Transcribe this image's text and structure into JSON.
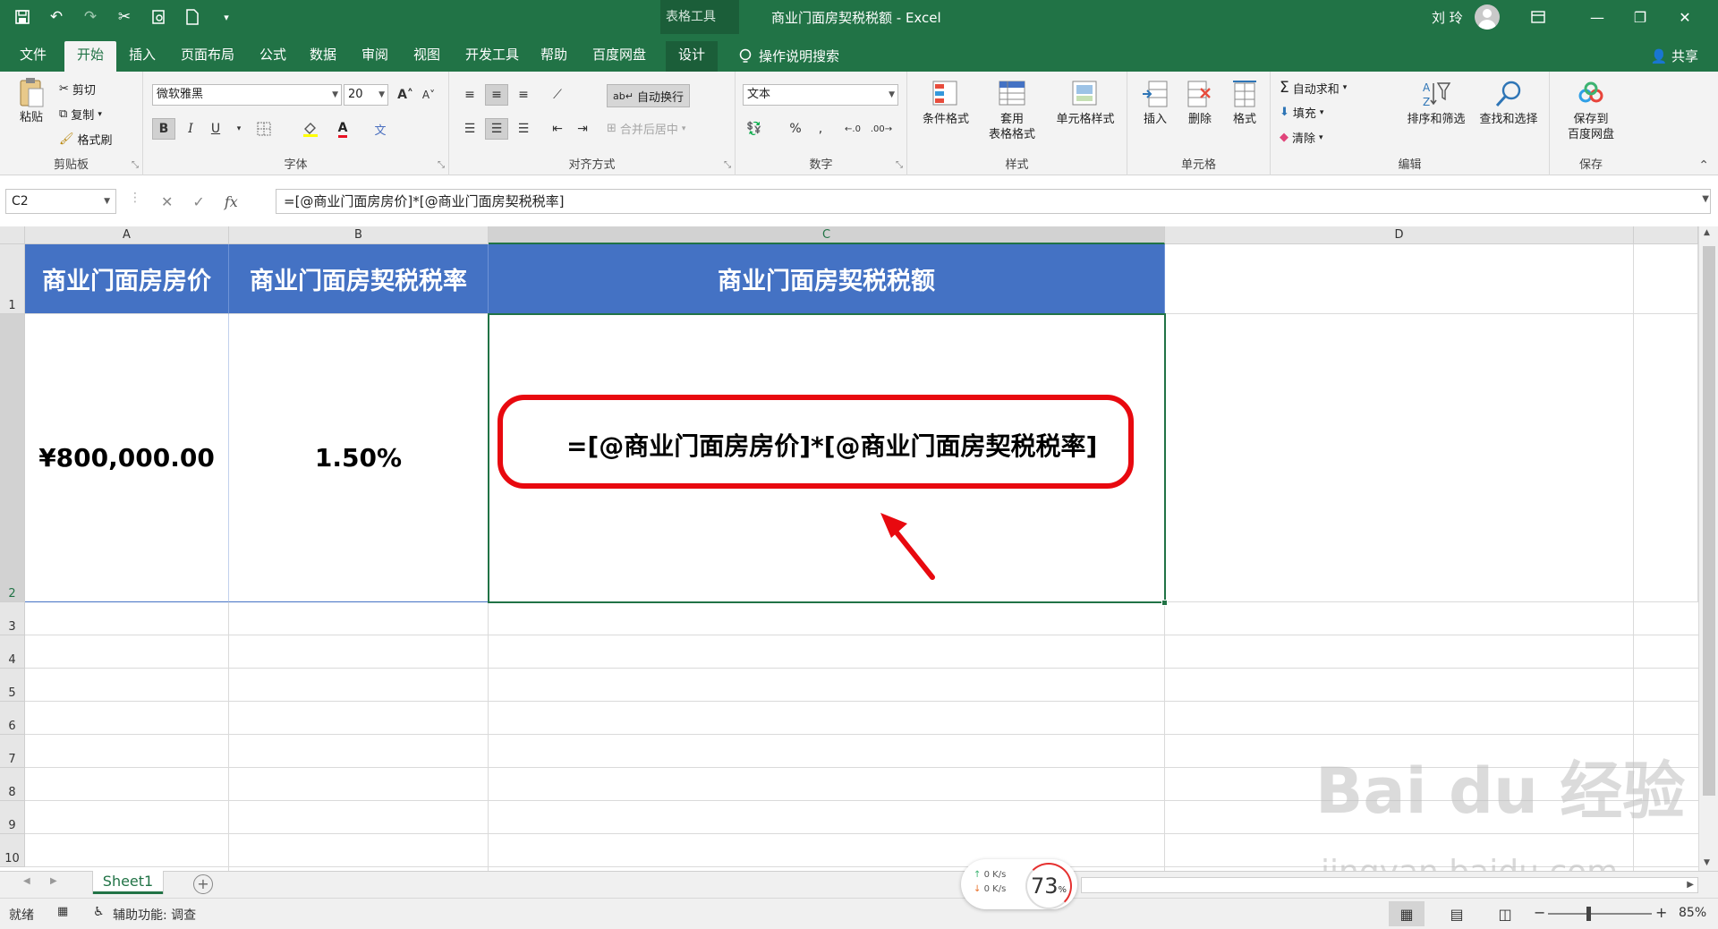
{
  "window": {
    "context_label": "表格工具",
    "title": "商业门面房契税税额 - Excel",
    "user": "刘 玲"
  },
  "tabs": [
    "文件",
    "开始",
    "插入",
    "页面布局",
    "公式",
    "数据",
    "审阅",
    "视图",
    "开发工具",
    "帮助",
    "百度网盘",
    "设计"
  ],
  "tell_me": "操作说明搜索",
  "share": "共享",
  "ribbon": {
    "clipboard": {
      "label": "剪贴板",
      "paste": "粘贴",
      "cut": "剪切",
      "copy": "复制",
      "format_painter": "格式刷"
    },
    "font": {
      "label": "字体",
      "name": "微软雅黑",
      "size": "20",
      "bold": "B",
      "italic": "I",
      "underline": "U",
      "grow": "A",
      "shrink": "A",
      "font_color": "A",
      "phonetic": "文"
    },
    "alignment": {
      "label": "对齐方式",
      "wrap": "自动换行",
      "merge": "合并后居中"
    },
    "number": {
      "label": "数字",
      "format": "文本",
      "percent": "%"
    },
    "styles": {
      "label": "样式",
      "conditional": "条件格式",
      "table_line1": "套用",
      "table_line2": "表格格式",
      "cell_styles": "单元格样式"
    },
    "cells": {
      "label": "单元格",
      "insert": "插入",
      "delete": "删除",
      "format": "格式"
    },
    "editing": {
      "label": "编辑",
      "autosum": "自动求和",
      "fill": "填充",
      "clear": "清除",
      "sort": "排序和筛选",
      "find": "查找和选择"
    },
    "save": {
      "label": "保存",
      "line1": "保存到",
      "line2": "百度网盘"
    }
  },
  "formula_bar": {
    "name_box": "C2",
    "formula": "=[@商业门面房房价]*[@商业门面房契税税率]"
  },
  "columns": [
    "A",
    "B",
    "C",
    "D"
  ],
  "rows": [
    "1",
    "2",
    "3",
    "4",
    "5",
    "6",
    "7",
    "8",
    "9",
    "10"
  ],
  "table": {
    "headers": [
      "商业门面房房价",
      "商业门面房契税税率",
      "商业门面房契税税额"
    ],
    "values": [
      "¥800,000.00",
      "1.50%",
      "=[@商业门面房房价]*[@商业门面房契税税率]"
    ]
  },
  "sheet_tab": "Sheet1",
  "status": {
    "ready": "就绪",
    "accessibility": "辅助功能: 调查",
    "zoom": "85%"
  },
  "net_widget": {
    "up": "0",
    "down": "0",
    "unit": "K/s",
    "percent": "73",
    "percent_sign": "%"
  },
  "watermark": {
    "line1": "Bai du 经验",
    "line2": "jingyan.baidu.com"
  },
  "colors": {
    "excel_green": "#217346",
    "table_header": "#4472c4",
    "highlight_red": "#e8090f"
  }
}
